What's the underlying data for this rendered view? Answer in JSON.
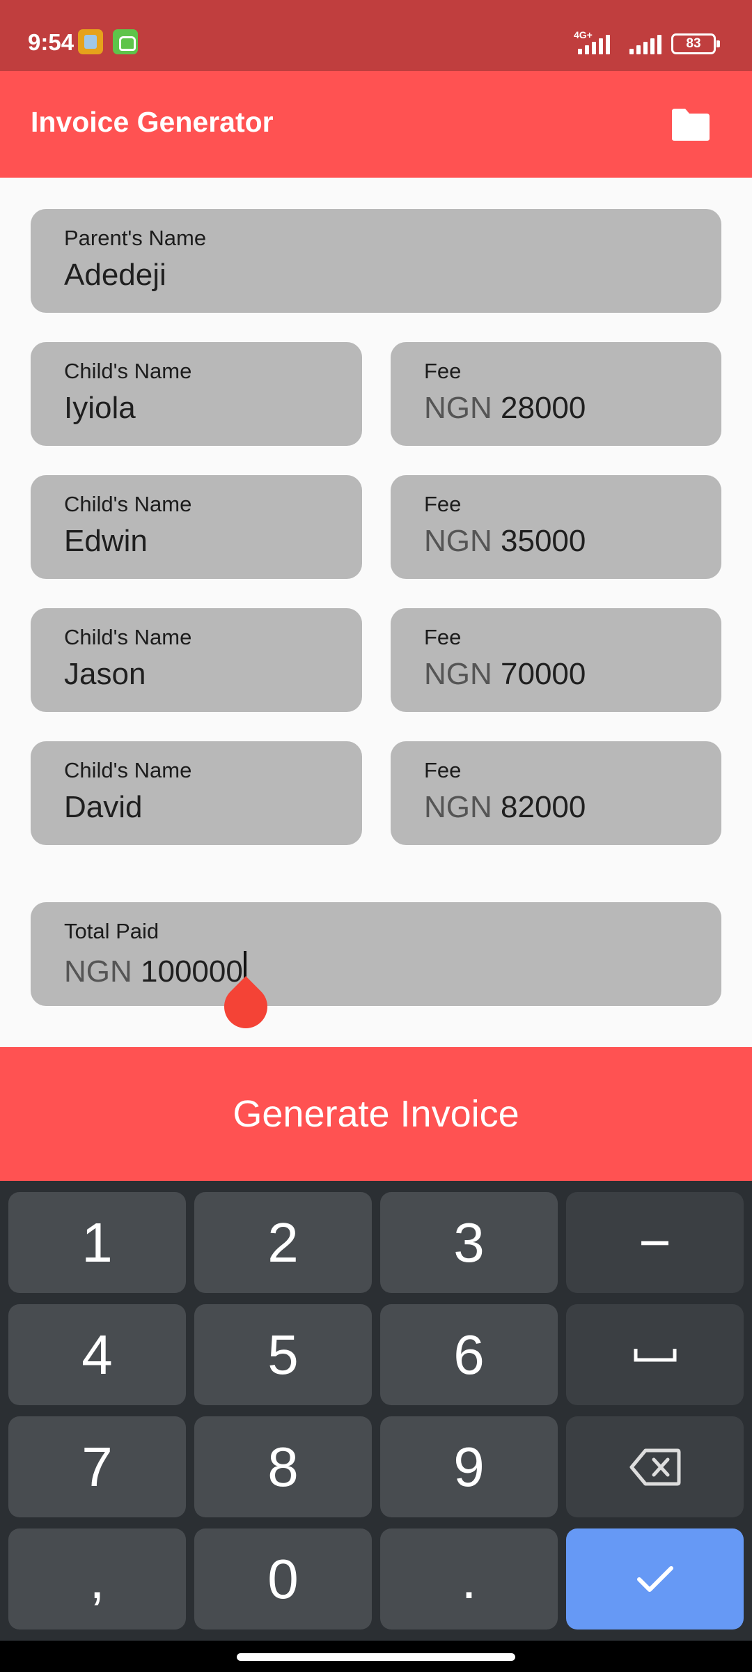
{
  "status_bar": {
    "time": "9:54",
    "network": "4G+",
    "battery": "83"
  },
  "app_bar": {
    "title": "Invoice Generator",
    "folder_icon": "folder-icon"
  },
  "form": {
    "parent": {
      "label": "Parent's Name",
      "value": "Adedeji"
    },
    "children": [
      {
        "name_label": "Child's Name",
        "name": "Iyiola",
        "fee_label": "Fee",
        "currency": "NGN",
        "fee": "28000"
      },
      {
        "name_label": "Child's Name",
        "name": "Edwin",
        "fee_label": "Fee",
        "currency": "NGN",
        "fee": "35000"
      },
      {
        "name_label": "Child's Name",
        "name": "Jason",
        "fee_label": "Fee",
        "currency": "NGN",
        "fee": "70000"
      },
      {
        "name_label": "Child's Name",
        "name": "David",
        "fee_label": "Fee",
        "currency": "NGN",
        "fee": "82000"
      }
    ],
    "total": {
      "label": "Total Paid",
      "currency": "NGN",
      "value": "100000"
    }
  },
  "generate_button": {
    "label": "Generate Invoice"
  },
  "keyboard": {
    "keys": [
      "1",
      "2",
      "3",
      "−",
      "4",
      "5",
      "6",
      "␣",
      "7",
      "8",
      "9",
      "⌫",
      ",",
      "0",
      ".",
      "✓"
    ],
    "space_icon": "space-icon",
    "backspace_icon": "backspace-icon",
    "enter_icon": "checkmark-icon"
  },
  "colors": {
    "status_bar": "#c03e3e",
    "primary": "#ff5252",
    "field_bg": "#b8b8b8",
    "keyboard_bg": "#2b2f33",
    "key_bg": "#484c50",
    "enter_key": "#6699f5"
  }
}
